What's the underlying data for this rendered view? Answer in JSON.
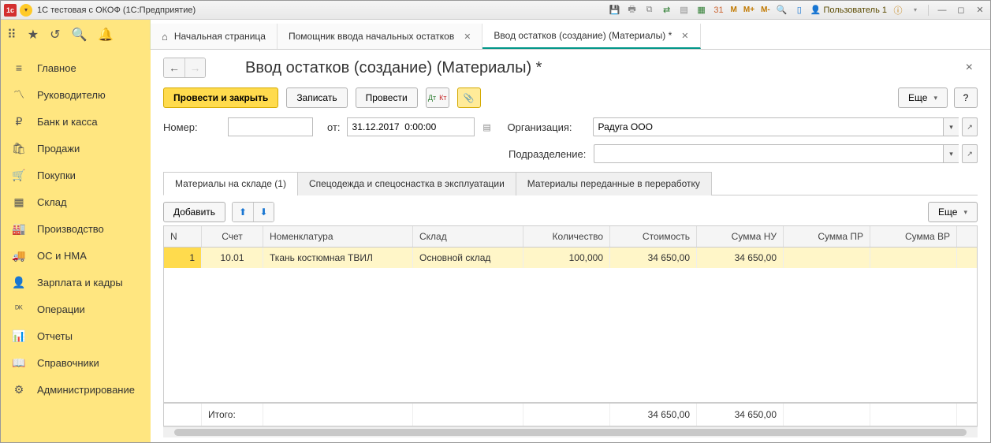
{
  "window": {
    "title": "1С тестовая с ОКОФ  (1С:Предприятие)",
    "user": "Пользователь 1"
  },
  "topTabs": {
    "home": "Начальная страница",
    "t1": "Помощник ввода начальных остатков",
    "t2": "Ввод остатков (создание) (Материалы) *"
  },
  "sidebar": {
    "items": [
      {
        "icon": "≡",
        "label": "Главное"
      },
      {
        "icon": "〽",
        "label": "Руководителю"
      },
      {
        "icon": "₽",
        "label": "Банк и касса"
      },
      {
        "icon": "🛍",
        "label": "Продажи"
      },
      {
        "icon": "🛒",
        "label": "Покупки"
      },
      {
        "icon": "▦",
        "label": "Склад"
      },
      {
        "icon": "🏭",
        "label": "Производство"
      },
      {
        "icon": "🚚",
        "label": "ОС и НМА"
      },
      {
        "icon": "👤",
        "label": "Зарплата и кадры"
      },
      {
        "icon": "ᴰᴷ",
        "label": "Операции"
      },
      {
        "icon": "📊",
        "label": "Отчеты"
      },
      {
        "icon": "📖",
        "label": "Справочники"
      },
      {
        "icon": "⚙",
        "label": "Администрирование"
      }
    ]
  },
  "page": {
    "title": "Ввод остатков (создание) (Материалы) *",
    "buttons": {
      "postClose": "Провести и закрыть",
      "write": "Записать",
      "post": "Провести",
      "more": "Еще",
      "help": "?"
    },
    "form": {
      "numberLabel": "Номер:",
      "numberValue": "",
      "fromLabel": "от:",
      "dateValue": "31.12.2017  0:00:00",
      "orgLabel": "Организация:",
      "orgValue": "Радуга ООО",
      "deptLabel": "Подразделение:",
      "deptValue": ""
    },
    "subtabs": {
      "t1": "Материалы на складе (1)",
      "t2": "Спецодежда и спецоснастка в эксплуатации",
      "t3": "Материалы переданные в переработку"
    },
    "tableTools": {
      "add": "Добавить",
      "more": "Еще"
    },
    "grid": {
      "headers": {
        "n": "N",
        "acct": "Счет",
        "nom": "Номенклатура",
        "wh": "Склад",
        "qty": "Количество",
        "cost": "Стоимость",
        "nu": "Сумма НУ",
        "pr": "Сумма ПР",
        "vr": "Сумма ВР"
      },
      "rows": [
        {
          "n": "1",
          "acct": "10.01",
          "nom": "Ткань костюмная ТВИЛ",
          "wh": "Основной склад",
          "qty": "100,000",
          "cost": "34 650,00",
          "nu": "34 650,00",
          "pr": "",
          "vr": ""
        }
      ],
      "totalLabel": "Итого:",
      "totals": {
        "cost": "34 650,00",
        "nu": "34 650,00"
      }
    }
  }
}
